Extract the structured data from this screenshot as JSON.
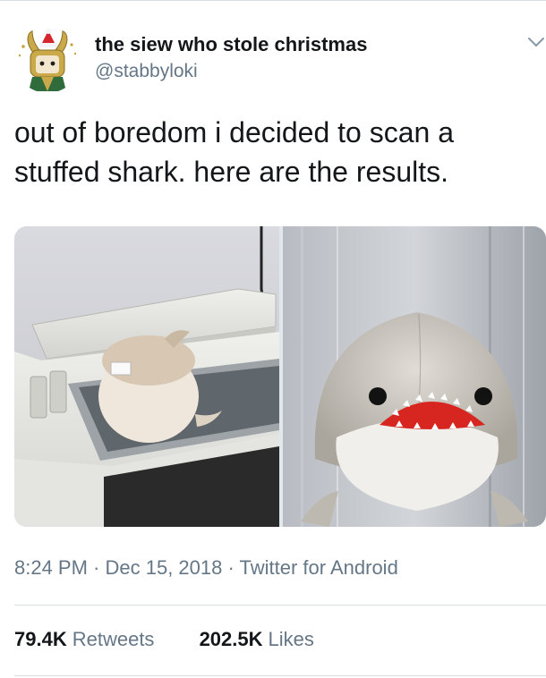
{
  "tweet": {
    "author": {
      "name": "the siew who stole christmas",
      "handle": "@stabbyloki"
    },
    "text_lines": [
      "out of boredom i decided to scan a",
      "stuffed shark. here are the results."
    ],
    "timestamp": "8:24 PM · Dec 15, 2018 · Twitter for Android",
    "stats": {
      "retweets_count": "79.4K",
      "retweets_label": "Retweets",
      "likes_count": "202.5K",
      "likes_label": "Likes"
    }
  },
  "icons": {
    "menu": "chevron-down-icon",
    "avatar": "loki-santa-hat-avatar"
  },
  "colors": {
    "text": "#14171a",
    "secondary": "#657786",
    "divider": "#d8dde2",
    "background": "#ffffff"
  }
}
